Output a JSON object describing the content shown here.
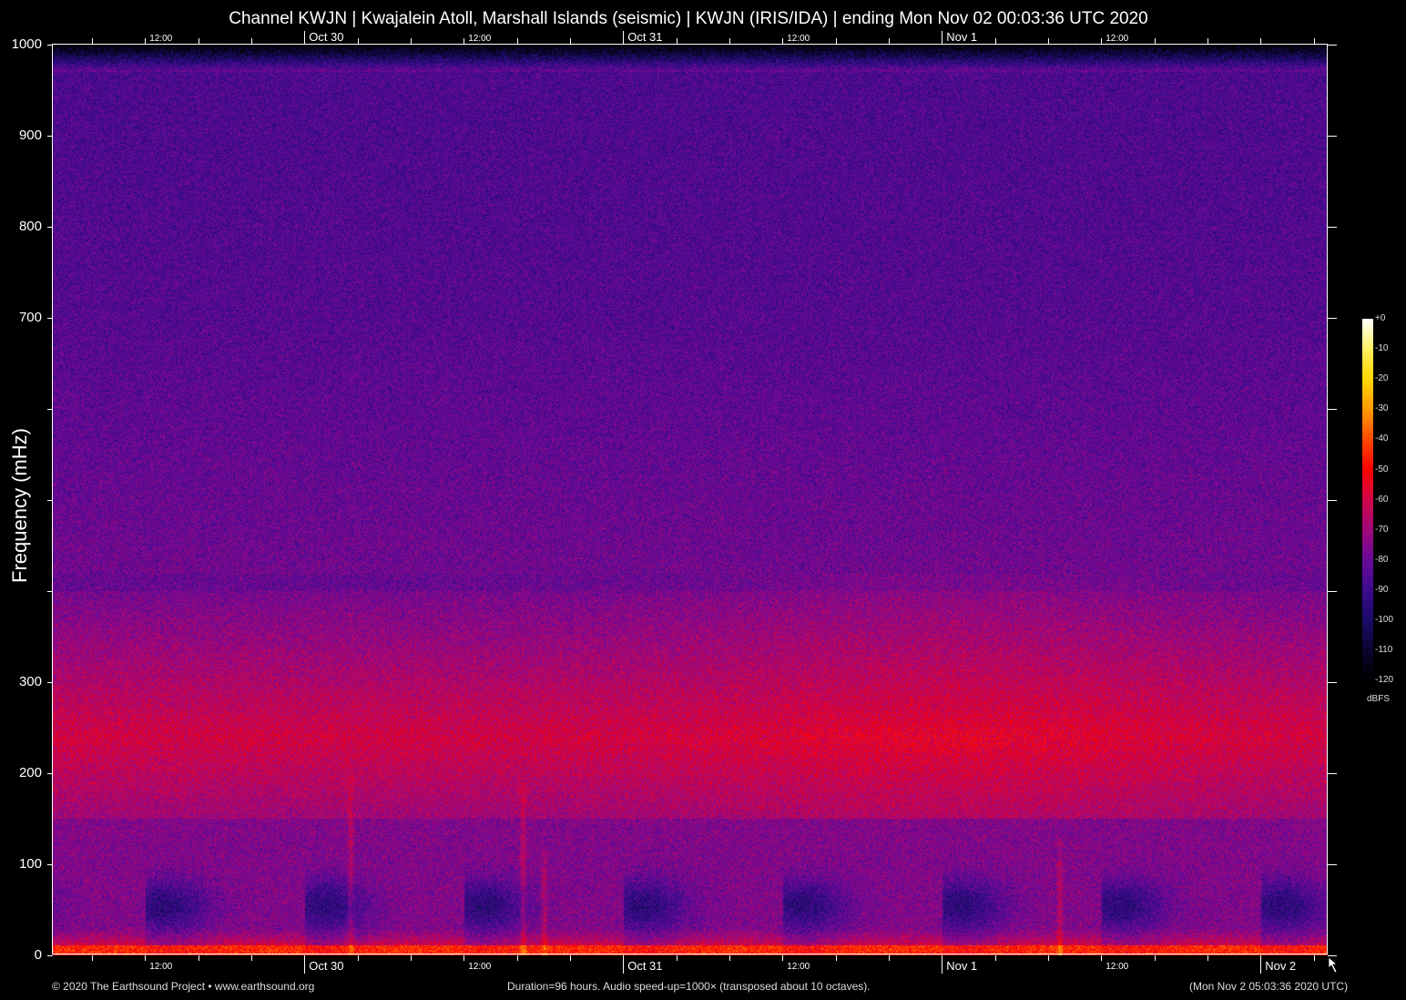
{
  "chart_data": {
    "type": "heatmap",
    "title": "Channel KWJN | Kwajalein Atoll, Marshall Islands (seismic) | KWJN (IRIS/IDA) | ending Mon Nov 02 00:03:36 UTC 2020",
    "ylabel": "Frequency (mHz)",
    "ylim": [
      0,
      1000
    ],
    "yticks": [
      0,
      100,
      200,
      300,
      400,
      500,
      600,
      700,
      800,
      900,
      1000
    ],
    "ytick_labels": [
      "0",
      "100",
      "200",
      "300",
      "",
      "",
      "",
      "700",
      "800",
      "900",
      "1000"
    ],
    "x_duration_hours": 96,
    "x_start_hour_of_day": 5.06,
    "x_tick_interval_hours": 4,
    "x_labels": [
      {
        "hour": 6.94,
        "text": "12:00",
        "kind": "small"
      },
      {
        "hour": 18.94,
        "text": "Oct 30",
        "kind": "day"
      },
      {
        "hour": 30.94,
        "text": "12:00",
        "kind": "small"
      },
      {
        "hour": 42.94,
        "text": "Oct 31",
        "kind": "day"
      },
      {
        "hour": 54.94,
        "text": "12:00",
        "kind": "small"
      },
      {
        "hour": 66.94,
        "text": "Nov  1",
        "kind": "day"
      },
      {
        "hour": 78.94,
        "text": "12:00",
        "kind": "small"
      },
      {
        "hour": 90.94,
        "text": "Nov  2",
        "kind": "day",
        "bottom_only": true
      }
    ],
    "colorbar": {
      "unit": "dBFS",
      "range": [
        -120,
        0
      ],
      "tick_labels": [
        "+0",
        "-10",
        "-20",
        "-30",
        "-40",
        "-50",
        "-60",
        "-70",
        "-80",
        "-90",
        "-100",
        "-110",
        "-120"
      ],
      "colors": [
        "#000000",
        "#0a0630",
        "#1c0c6a",
        "#3d0b8e",
        "#6a0a9a",
        "#a0087a",
        "#d0064a",
        "#ff0000",
        "#ff4a00",
        "#ff9a00",
        "#ffd800",
        "#fff060",
        "#ffffff"
      ]
    },
    "levels_dbfs": {
      "high_freq": -85,
      "band_200_300": -58,
      "band_below_20": -45,
      "diurnal_minimum_30_80": -95,
      "above_970": -120
    }
  },
  "footer": {
    "copyright": "© 2020 The Earthsound Project • www.earthsound.org",
    "duration": "Duration=96 hours. Audio speed-up=1000× (transposed about 10 octaves).",
    "end_time": "(Mon Nov  2 05:03:36 2020 UTC)"
  }
}
